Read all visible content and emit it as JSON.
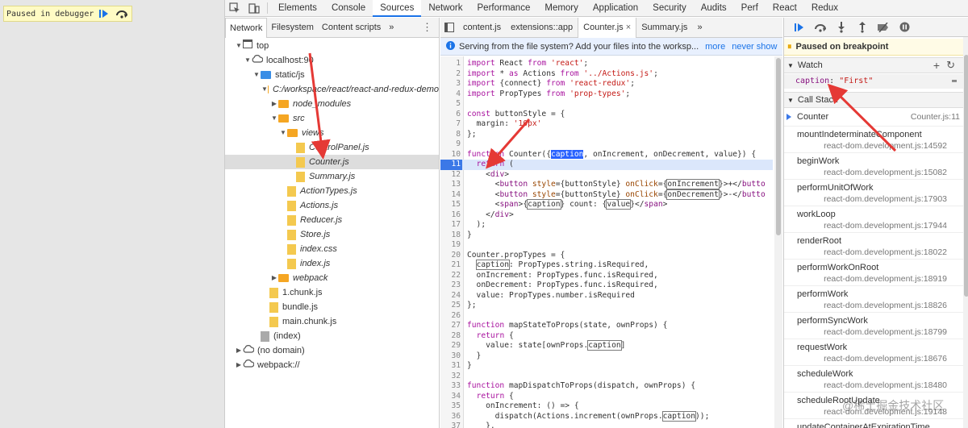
{
  "banner": {
    "text": "Paused in debugger"
  },
  "devtools": {
    "tabs": [
      "Elements",
      "Console",
      "Sources",
      "Network",
      "Performance",
      "Memory",
      "Application",
      "Security",
      "Audits",
      "Perf",
      "React",
      "Redux"
    ],
    "active_tab": "Sources"
  },
  "navigator": {
    "tabs": [
      "Network",
      "Filesystem",
      "Content scripts"
    ],
    "more": "»",
    "tree": [
      {
        "label": "top",
        "indent": 0,
        "kind": "frame",
        "tri": "▼"
      },
      {
        "label": "localhost:90",
        "indent": 1,
        "kind": "cloud",
        "tri": "▼"
      },
      {
        "label": "static/js",
        "indent": 2,
        "kind": "folder-blue",
        "tri": "▼"
      },
      {
        "label": "C:/workspace/react/react-and-redux-demo",
        "indent": 3,
        "kind": "folder",
        "tri": "▼",
        "italic": true
      },
      {
        "label": "node_modules",
        "indent": 4,
        "kind": "folder",
        "tri": "▶",
        "italic": true
      },
      {
        "label": "src",
        "indent": 4,
        "kind": "folder",
        "tri": "▼",
        "italic": true
      },
      {
        "label": "views",
        "indent": 5,
        "kind": "folder",
        "tri": "▼",
        "italic": true
      },
      {
        "label": "ControlPanel.js",
        "indent": 6,
        "kind": "file",
        "italic": true
      },
      {
        "label": "Counter.js",
        "indent": 6,
        "kind": "file",
        "italic": true,
        "selected": true
      },
      {
        "label": "Summary.js",
        "indent": 6,
        "kind": "file",
        "italic": true
      },
      {
        "label": "ActionTypes.js",
        "indent": 5,
        "kind": "file",
        "italic": true
      },
      {
        "label": "Actions.js",
        "indent": 5,
        "kind": "file",
        "italic": true
      },
      {
        "label": "Reducer.js",
        "indent": 5,
        "kind": "file",
        "italic": true
      },
      {
        "label": "Store.js",
        "indent": 5,
        "kind": "file",
        "italic": true
      },
      {
        "label": "index.css",
        "indent": 5,
        "kind": "file",
        "italic": true
      },
      {
        "label": "index.js",
        "indent": 5,
        "kind": "file",
        "italic": true
      },
      {
        "label": "webpack",
        "indent": 4,
        "kind": "folder",
        "tri": "▶",
        "italic": true
      },
      {
        "label": "1.chunk.js",
        "indent": 3,
        "kind": "file"
      },
      {
        "label": "bundle.js",
        "indent": 3,
        "kind": "file"
      },
      {
        "label": "main.chunk.js",
        "indent": 3,
        "kind": "file"
      },
      {
        "label": "(index)",
        "indent": 2,
        "kind": "file-gray"
      },
      {
        "label": "(no domain)",
        "indent": 0,
        "kind": "cloud",
        "tri": "▶"
      },
      {
        "label": "webpack://",
        "indent": 0,
        "kind": "cloud",
        "tri": "▶"
      }
    ]
  },
  "editor": {
    "tabs": [
      "content.js",
      "extensions::app",
      "Counter.js",
      "Summary.js"
    ],
    "active_tab": "Counter.js",
    "infobar": {
      "message": "Serving from the file system? Add your files into the worksp...",
      "more": "more",
      "never_show": "never show"
    },
    "exec_line": 11,
    "lines": [
      {
        "n": "1",
        "code": "<span class='kw'>import</span> React <span class='kw'>from</span> <span class='str'>'react'</span>;"
      },
      {
        "n": "2",
        "code": "<span class='kw'>import</span> * <span class='kw'>as</span> Actions <span class='kw'>from</span> <span class='str'>'../Actions.js'</span>;"
      },
      {
        "n": "3",
        "code": "<span class='kw'>import</span> {connect} <span class='kw'>from</span> <span class='str'>'react-redux'</span>;"
      },
      {
        "n": "4",
        "code": "<span class='kw'>import</span> PropTypes <span class='kw'>from</span> <span class='str'>'prop-types'</span>;"
      },
      {
        "n": "5",
        "code": ""
      },
      {
        "n": "6",
        "code": "<span class='kw'>const</span> buttonStyle = {"
      },
      {
        "n": "7",
        "code": "  margin: <span class='str'>'10px'</span>"
      },
      {
        "n": "8",
        "code": "};"
      },
      {
        "n": "9",
        "code": ""
      },
      {
        "n": "10",
        "code": "<span class='kw'>function</span> Counter({<span class='hl'>caption</span>, onIncrement, onDecrement, value}) {"
      },
      {
        "n": "11",
        "code": "  <span class='kw'>return</span> ("
      },
      {
        "n": "12",
        "code": "    &lt;<span class='tag'>div</span>&gt;"
      },
      {
        "n": "13",
        "code": "      &lt;<span class='tag'>button</span> <span class='attr'>style</span>={buttonStyle} <span class='attr'>onClick</span>={<span class='box'>onIncrement</span>}&gt;+&lt;/<span class='tag'>butto</span>"
      },
      {
        "n": "14",
        "code": "      &lt;<span class='tag'>button</span> <span class='attr'>style</span>={buttonStyle} <span class='attr'>onClick</span>={<span class='box'>onDecrement</span>}&gt;-&lt;/<span class='tag'>butto</span>"
      },
      {
        "n": "15",
        "code": "      &lt;<span class='tag'>span</span>&gt;{<span class='box'>caption</span>} count: {<span class='box'>value</span>}&lt;/<span class='tag'>span</span>&gt;"
      },
      {
        "n": "16",
        "code": "    &lt;/<span class='tag'>div</span>&gt;"
      },
      {
        "n": "17",
        "code": "  );"
      },
      {
        "n": "18",
        "code": "}"
      },
      {
        "n": "19",
        "code": ""
      },
      {
        "n": "20",
        "code": "Counter.propTypes = {"
      },
      {
        "n": "21",
        "code": "  <span class='box'>caption</span>: PropTypes.string.isRequired,"
      },
      {
        "n": "22",
        "code": "  onIncrement: PropTypes.func.isRequired,"
      },
      {
        "n": "23",
        "code": "  onDecrement: PropTypes.func.isRequired,"
      },
      {
        "n": "24",
        "code": "  value: PropTypes.number.isRequired"
      },
      {
        "n": "25",
        "code": "};"
      },
      {
        "n": "26",
        "code": ""
      },
      {
        "n": "27",
        "code": "<span class='kw'>function</span> mapStateToProps(state, ownProps) {"
      },
      {
        "n": "28",
        "code": "  <span class='kw'>return</span> {"
      },
      {
        "n": "29",
        "code": "    value: state[ownProps.<span class='box'>caption</span>]"
      },
      {
        "n": "30",
        "code": "  }"
      },
      {
        "n": "31",
        "code": "}"
      },
      {
        "n": "32",
        "code": ""
      },
      {
        "n": "33",
        "code": "<span class='kw'>function</span> mapDispatchToProps(dispatch, ownProps) {"
      },
      {
        "n": "34",
        "code": "  <span class='kw'>return</span> {"
      },
      {
        "n": "35",
        "code": "    onIncrement: () =&gt; {"
      },
      {
        "n": "36",
        "code": "      dispatch(Actions.increment(ownProps.<span class='box'>caption</span>));"
      },
      {
        "n": "37",
        "code": "    },"
      }
    ]
  },
  "debugger": {
    "paused_message": "Paused on breakpoint",
    "watch": {
      "title": "Watch",
      "expr_name": "caption",
      "expr_value": "\"First\""
    },
    "callstack": {
      "title": "Call Stack",
      "frames": [
        {
          "name": "Counter",
          "loc": "Counter.js:11",
          "current": true
        },
        {
          "name": "mountIndeterminateComponent",
          "loc": "react-dom.development.js:14592"
        },
        {
          "name": "beginWork",
          "loc": "react-dom.development.js:15082"
        },
        {
          "name": "performUnitOfWork",
          "loc": "react-dom.development.js:17903"
        },
        {
          "name": "workLoop",
          "loc": "react-dom.development.js:17944"
        },
        {
          "name": "renderRoot",
          "loc": "react-dom.development.js:18022"
        },
        {
          "name": "performWorkOnRoot",
          "loc": "react-dom.development.js:18919"
        },
        {
          "name": "performWork",
          "loc": "react-dom.development.js:18826"
        },
        {
          "name": "performSyncWork",
          "loc": "react-dom.development.js:18799"
        },
        {
          "name": "requestWork",
          "loc": "react-dom.development.js:18676"
        },
        {
          "name": "scheduleWork",
          "loc": "react-dom.development.js:18480"
        },
        {
          "name": "scheduleRootUpdate",
          "loc": "react-dom.development.js:19148"
        },
        {
          "name": "updateContainerAtExpirationTime",
          "loc": ""
        }
      ]
    }
  },
  "watermark": "@稀土掘金技术社区",
  "colors": {
    "accent": "#1a73e8",
    "banner": "#fffbc4",
    "annotation": "#e53935",
    "exec_line": "#3b78e7"
  }
}
